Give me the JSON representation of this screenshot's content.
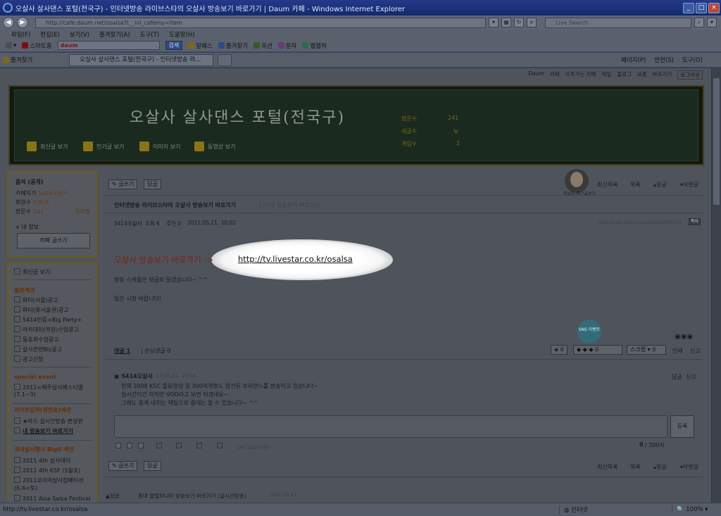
{
  "window": {
    "title": "오살사 살사댄스 포털(전국구) - 인터넷방송 라이브스타의 오살사 방송보기 바로가기 | Daum 카페 - Windows Internet Explorer"
  },
  "browser": {
    "address": "http://cafe.daum.net/osalsa?t__nil_cafemy=item",
    "search_placeholder": "Live Search",
    "menu": [
      "파일(F)",
      "편집(E)",
      "보기(V)",
      "즐겨찾기(A)",
      "도구(T)",
      "도움말(H)"
    ],
    "toolbar": {
      "smart_home": "스마트홈",
      "daum_search": "daum",
      "search_btn": "검색",
      "items": [
        "알패스",
        "즐겨찾기",
        "옥션",
        "문자",
        "웹캡처"
      ]
    },
    "favorites": "즐겨찾기",
    "tab_title": "오살사 살사댄스 포털(전국구) - 인터넷방송 라...",
    "commands": [
      "페이지(P)",
      "안전(S)",
      "도구(O)"
    ],
    "status_url": "http://tv.livestar.co.kr/osalsa",
    "status_zone": "인터넷",
    "zoom": "100%"
  },
  "topnav": {
    "items": [
      "Daum",
      "카페",
      "자주가는 카페",
      "메일",
      "블로그",
      "요즘",
      "바로가기"
    ],
    "login": "로그아웃"
  },
  "banner": {
    "cafe_title": "오살사 살사댄스 포털(전국구)",
    "nav": [
      "최신글 보기",
      "인기글 보기",
      "이미지 보기",
      "동영상 보기"
    ],
    "stats": [
      {
        "label": "방문수",
        "value": "241"
      },
      {
        "label": "새글수",
        "value": "뉴"
      },
      {
        "label": "게임수",
        "value": "2"
      }
    ]
  },
  "leftpanel": {
    "user": "음석 (공개)",
    "rows": [
      {
        "label": "카페지기",
        "value": "5414오살사"
      },
      {
        "label": "회원수",
        "value": "7,816"
      },
      {
        "label": "방문수",
        "value": "241"
      }
    ],
    "rank": "프로필",
    "myinfo": "내 정보",
    "write_btn": "카페 글쓰기",
    "recent": "최신글 보기",
    "sections": [
      {
        "title": "홍보섹션",
        "items": [
          "파티(서울)광고",
          "파티(非서울권)광고",
          "5414인증+Big Party+",
          "아카데미(학원)수업광고",
          "동호회수업광고",
          "살사관련Biz광고",
          "광고신청"
        ]
      },
      {
        "title": "special event",
        "items": [
          "2011=제주살사페스티벌(7.1~3)"
        ]
      },
      {
        "title": "라이브강좌(생방송)섹션",
        "items": [
          "★라스 실시간방송 편성판",
          "내 방송보기 바로가기"
        ]
      },
      {
        "title": "국내살사행사 Big6-섹션",
        "items": [
          "2011 4th 살사데이",
          "2011 4th KSF (5월초)",
          "2011코리아살사컴페티션(6.4=토)",
          "2011 Asia Salsa Festival"
        ]
      }
    ]
  },
  "post": {
    "write_btn": "글쓰기",
    "reply_btn": "답글",
    "list_nav": [
      "최신목록",
      "목록",
      "윗글",
      "아랫글"
    ],
    "title": "인터넷방송 라이브스타의 오살사 방송보기 바로가기",
    "board": "내 방송보기 바로가기",
    "author": "5414오살사",
    "views": "조회 6",
    "recommend": "추천 0",
    "date": "2011.05.21. 10:02",
    "permalink": "http://cafe.daum.net/osalsa/K3KY/21",
    "body_lead": "오살사 방송보기 바로가기 ->",
    "body_link": "http://tv.livestar.co.kr/osalsa",
    "body_lines": [
      "방송 스케줄은 댓글로 달겠습니다~ ^^",
      "많은 시청 바랍니다!"
    ],
    "sns_label": "SNS 이벤트",
    "comments_label": "댓글 1",
    "guest_label": "손님댓글 0",
    "actions": [
      "0",
      "0",
      "스크랩",
      "0",
      "인쇄",
      "신고"
    ],
    "avatar_caption": "작성자 최근글보기"
  },
  "comment": {
    "author": "5414오살사",
    "date": "11.05.21. 10:18",
    "text": [
      "현재 2008 KSC 졸동영상 및 300여개정도 엄선된 프리댄스를 방송하고 있습니다~",
      "실시간이긴 하지만 VOD라고 보면 되겠네요~",
      "그래도 중게 내지는 채팅으로 중대는 할 수 있습니다~ ^^"
    ],
    "actions": [
      "답글",
      "신고"
    ],
    "register_btn": "등록",
    "sns_share": "SNS 내보내기란?",
    "char_count": "0",
    "char_max": "/ 300자"
  },
  "bottom": {
    "list_nav": [
      "최신목록",
      "목록",
      "윗글",
      "아랫글"
    ],
    "prev_label": "▲윗글",
    "prev_title": "홍대 클럽보니따 방송보기 바로가기 (실시간방송)",
    "prev_date": "2011.05.21"
  }
}
